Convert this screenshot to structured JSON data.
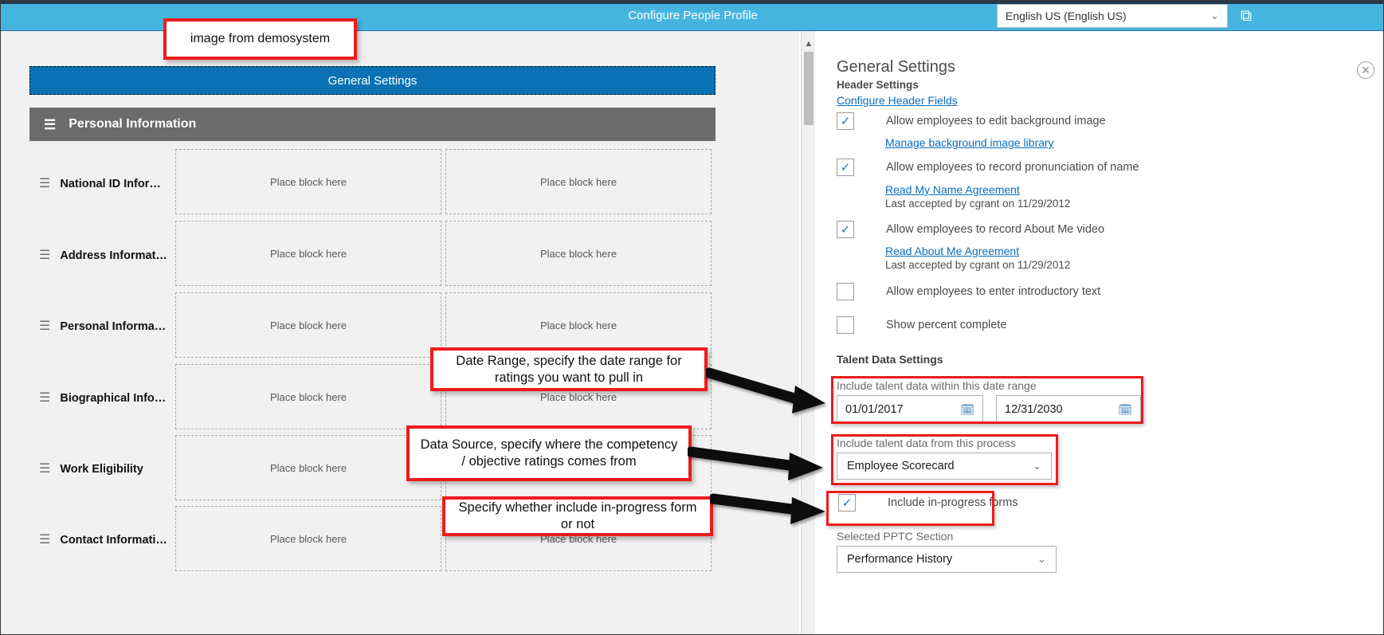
{
  "topbar": {
    "title": "Configure People Profile",
    "language": "English US (English US)",
    "chevron": "⌄",
    "corner_icon": "⧉"
  },
  "workspace": {
    "general_settings_tab": "General Settings",
    "section_header": "Personal Information",
    "hamburger": "☰",
    "placeholder_text": "Place block here",
    "rows": [
      {
        "label": "National ID Infor…"
      },
      {
        "label": "Address Informat…"
      },
      {
        "label": "Personal Informa…"
      },
      {
        "label": "Biographical Info…"
      },
      {
        "label": "Work Eligibility"
      },
      {
        "label": "Contact Informati…"
      }
    ]
  },
  "annotations": {
    "source_note": "image from demosystem",
    "callouts": [
      {
        "text": "Date Range, specify the date range for ratings you want to pull in"
      },
      {
        "text": "Data Source, specify where the competency / objective ratings comes from"
      },
      {
        "text": "Specify whether include in-progress form or not"
      }
    ]
  },
  "panel": {
    "title": "General Settings",
    "subtitle": "Header Settings",
    "configure_header_fields_link": "Configure Header Fields",
    "close_icon": "✕",
    "checkboxes": [
      {
        "label": "Allow employees to edit background image",
        "checked": true
      },
      {
        "label": "Allow employees to record pronunciation of name",
        "checked": true
      },
      {
        "label": "Allow employees to record About Me video",
        "checked": true
      },
      {
        "label": "Allow employees to enter introductory text",
        "checked": false
      },
      {
        "label": "Show percent complete",
        "checked": false
      }
    ],
    "links": [
      {
        "text": "Manage background image library"
      },
      {
        "text": "Read My Name Agreement"
      },
      {
        "text": "Read About Me Agreement"
      }
    ],
    "notes": [
      {
        "text": "Last accepted by cgrant on 11/29/2012"
      },
      {
        "text": "Last accepted by cgrant on 11/29/2012"
      }
    ],
    "talent_group_header": "Talent Data Settings",
    "date_range_label": "Include talent data within this date range",
    "date_from": "01/01/2017",
    "date_to": "12/31/2030",
    "calendar_icon": "Ὄ5",
    "process_label": "Include talent data from this process",
    "process_value": "Employee Scorecard",
    "in_progress_label": "Include in-progress forms",
    "in_progress_checked": true,
    "pptc_label": "Selected PPTC Section",
    "pptc_value": "Performance History",
    "chevron": "⌄"
  },
  "colors": {
    "topbar": "#45b5e0",
    "tab_blue": "#0a72b4",
    "section_gray": "#6b6b6b",
    "link_blue": "#0a6ebd",
    "highlight_red": "#ee1b1b"
  }
}
